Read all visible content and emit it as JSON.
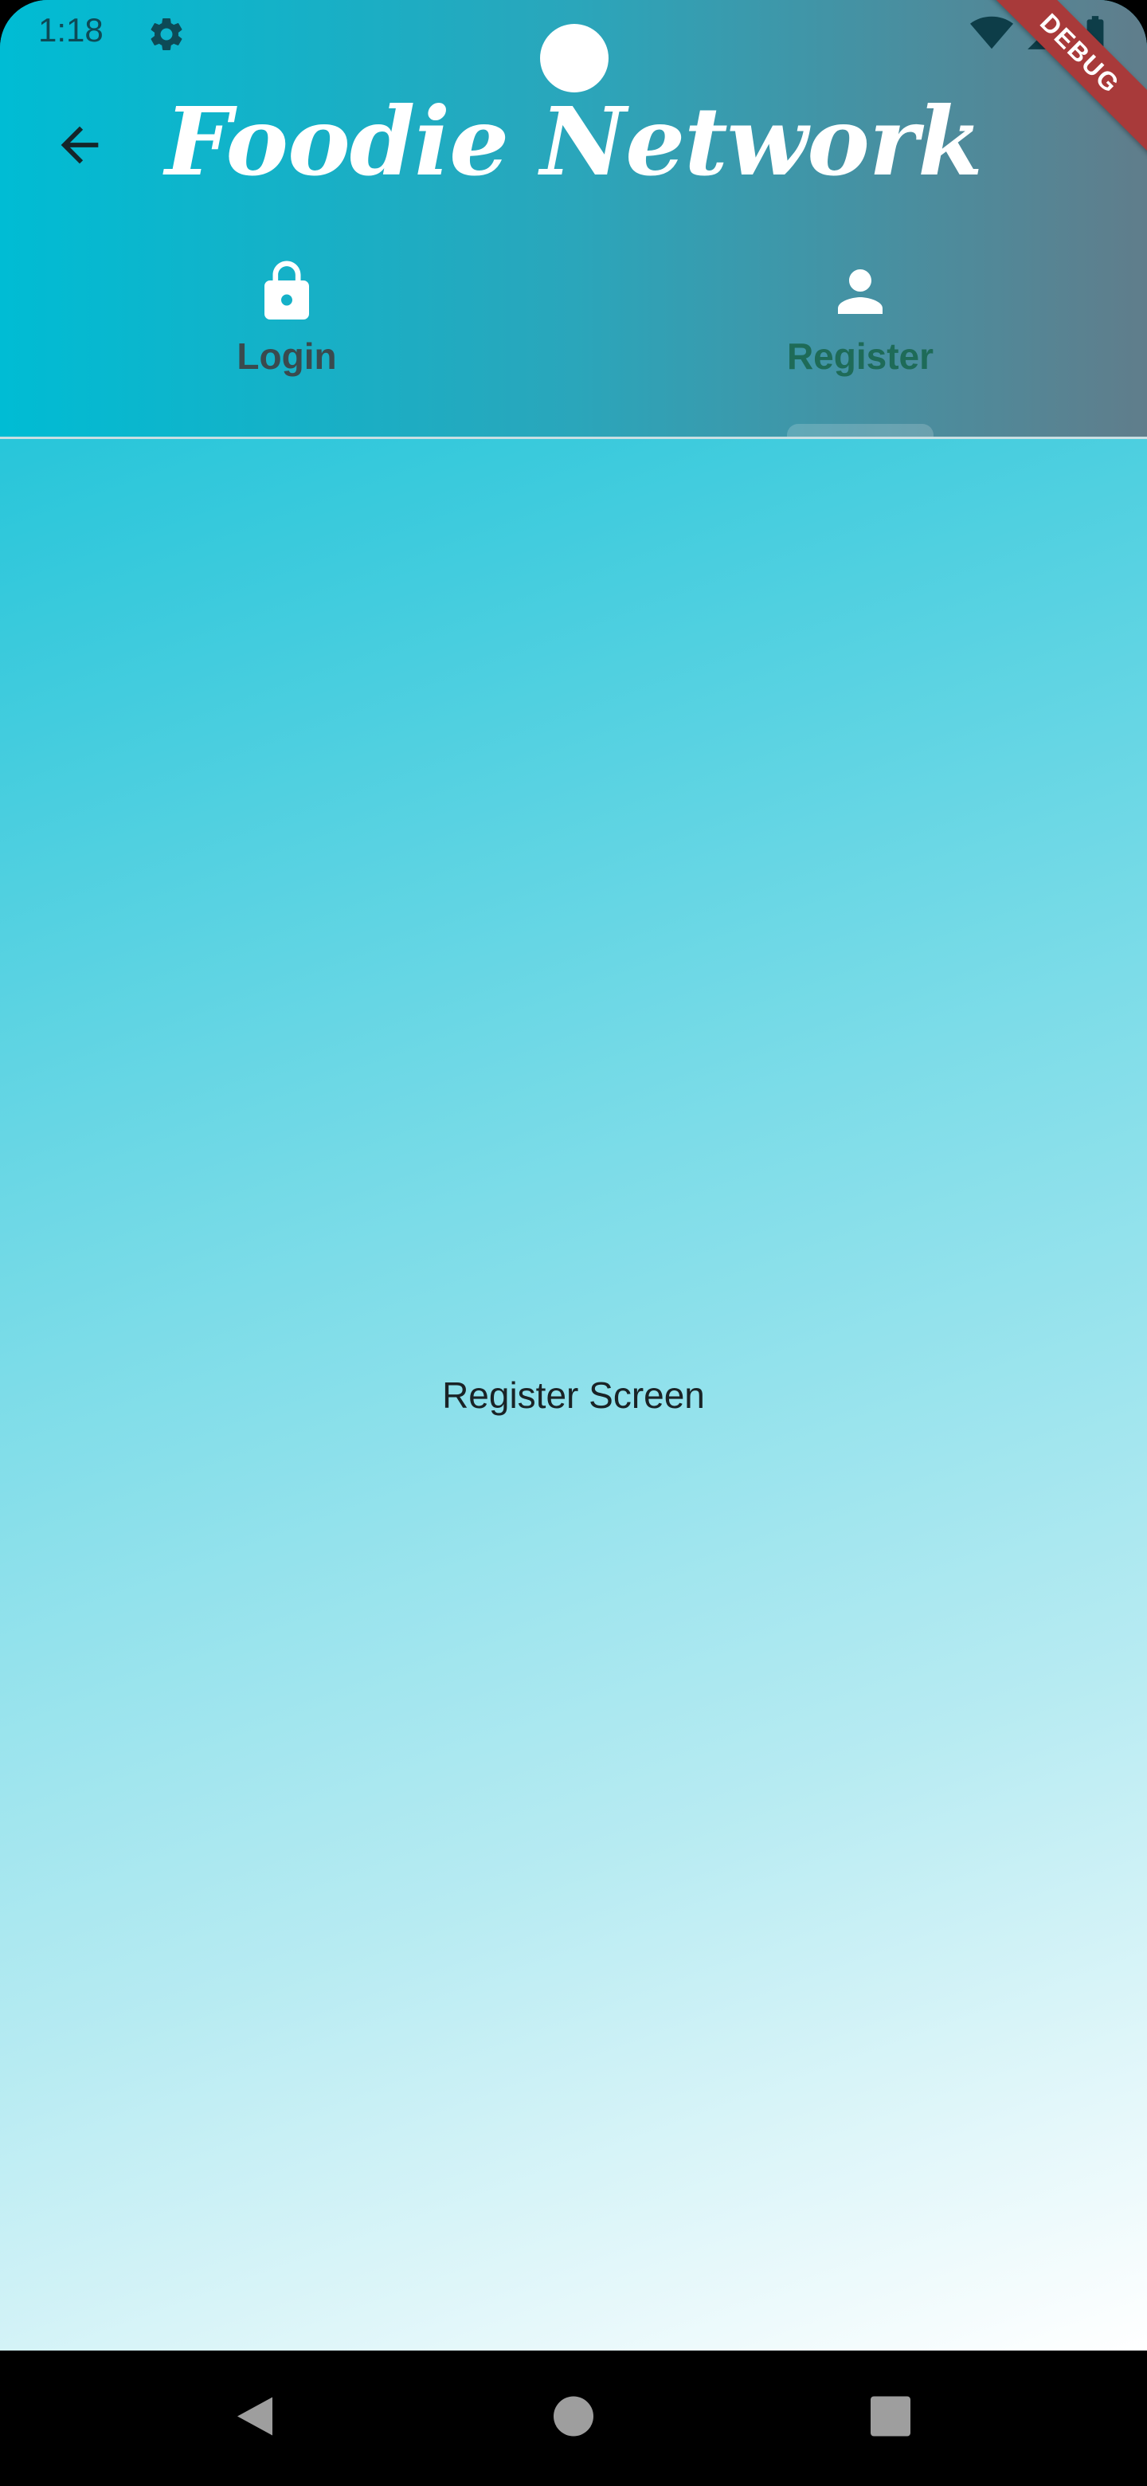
{
  "status_bar": {
    "time": "1:18",
    "icons": [
      "settings-gear-icon",
      "wifi-icon",
      "signal-icon",
      "battery-icon"
    ]
  },
  "debug_banner": "DEBUG",
  "app_bar": {
    "title": "Foodie Network",
    "back_icon": "arrow-back-icon"
  },
  "tabs": [
    {
      "label": "Login",
      "icon": "lock-icon",
      "selected": false
    },
    {
      "label": "Register",
      "icon": "person-icon",
      "selected": true
    }
  ],
  "content": {
    "text": "Register Screen"
  },
  "nav_bar": {
    "buttons": [
      "back-triangle-icon",
      "home-circle-icon",
      "recents-square-icon"
    ]
  },
  "colors": {
    "gradient_start": "#00bcd4",
    "gradient_end": "#ffffff",
    "appbar_right": "#607d8b",
    "selected_tab": "#1e6b58",
    "debug_banner": "#a83a3a"
  }
}
